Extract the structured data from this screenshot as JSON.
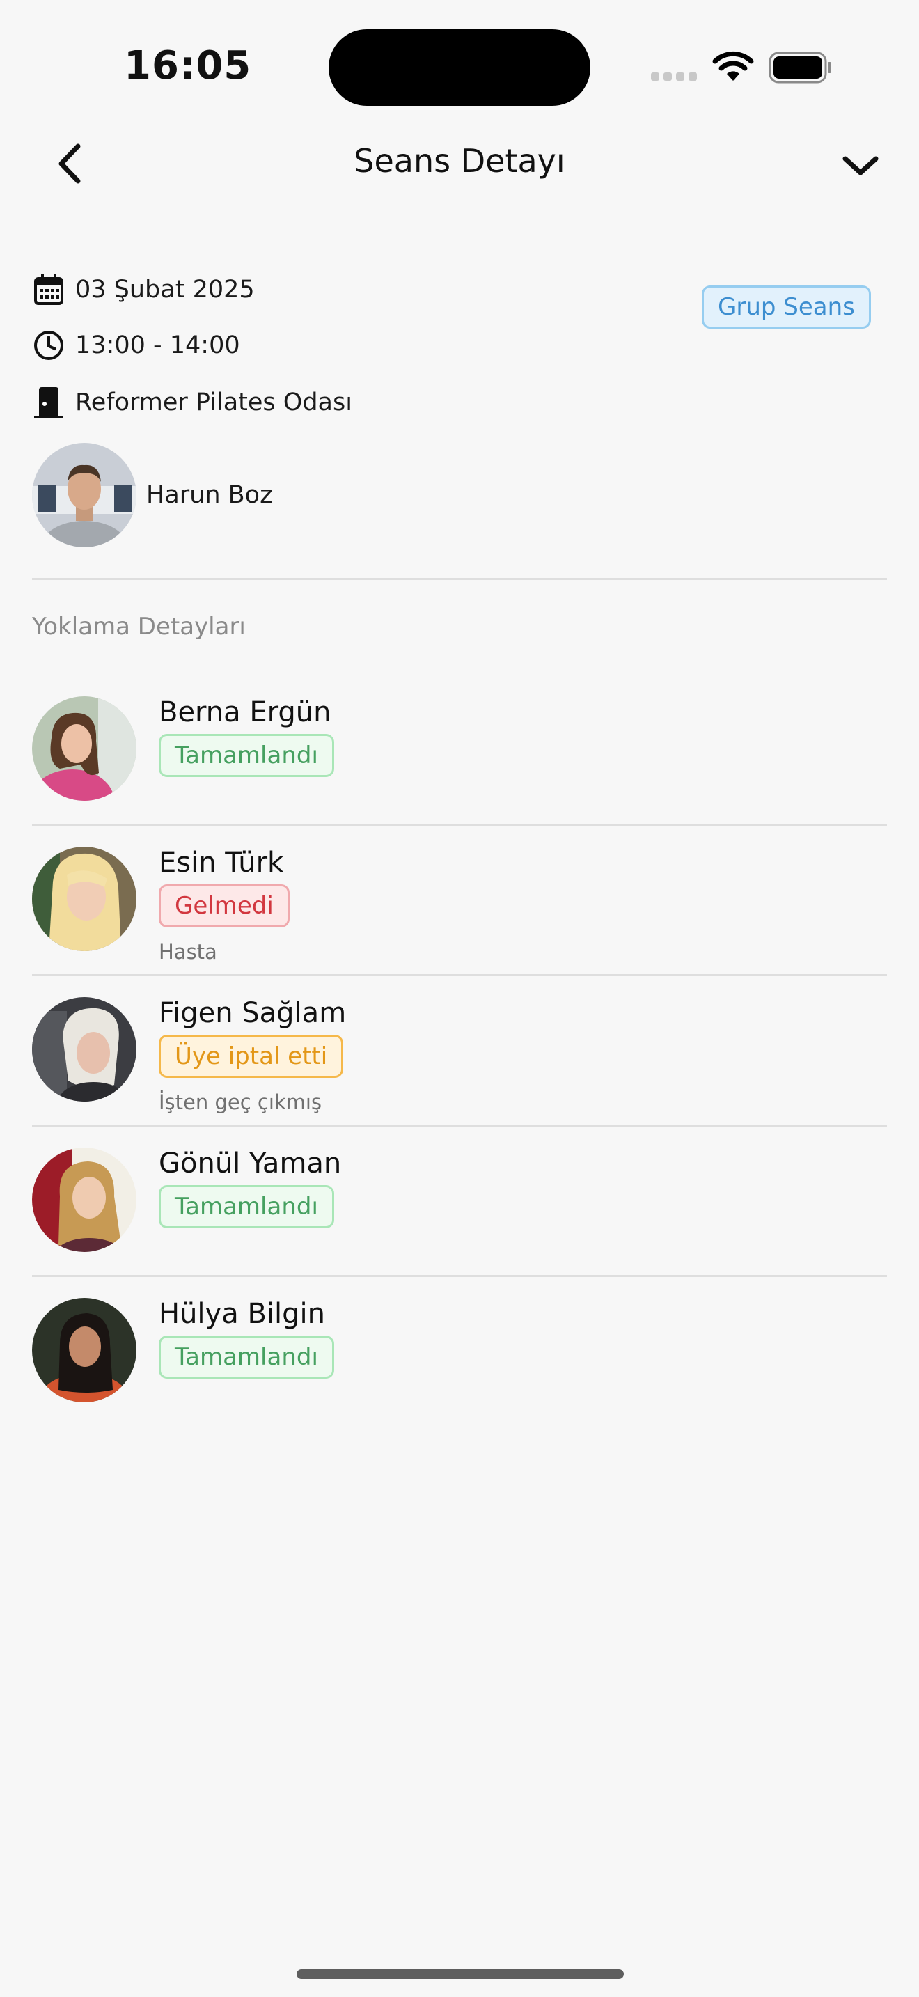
{
  "status_bar": {
    "time": "16:05"
  },
  "nav": {
    "title": "Seans Detayı",
    "back_icon": "chevron-left-icon",
    "menu_icon": "chevron-down-icon"
  },
  "session": {
    "date": "03 Şubat 2025",
    "time_range": "13:00 - 14:00",
    "room": "Reformer Pilates Odası",
    "type_badge": "Grup Seans",
    "trainer": "Harun Boz"
  },
  "attendance": {
    "label": "Yoklama Detayları",
    "items": [
      {
        "name": "Berna Ergün",
        "status": "Tamamlandı",
        "note": ""
      },
      {
        "name": "Esin Türk",
        "status": "Gelmedi",
        "note": "Hasta"
      },
      {
        "name": "Figen Sağlam",
        "status": "Üye iptal etti",
        "note": "İşten geç çıkmış"
      },
      {
        "name": "Gönül Yaman",
        "status": "Tamamlandı",
        "note": ""
      },
      {
        "name": "Hülya Bilgin",
        "status": "Tamamlandı",
        "note": ""
      }
    ]
  },
  "colors": {
    "completed": "#46a060",
    "absent": "#d2373f",
    "cancelled": "#e39718",
    "group_badge": "#3d8ed0"
  }
}
